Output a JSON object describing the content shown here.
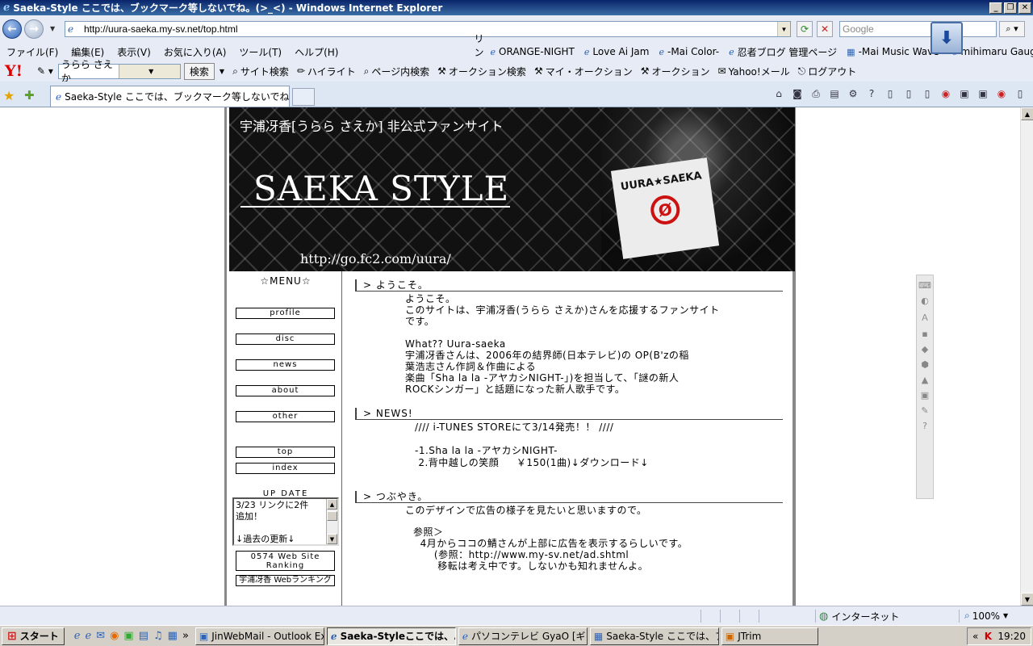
{
  "window": {
    "title": "Saeka-Style ここでは、ブックマーク等しないでね。(>_<) - Windows Internet Explorer",
    "btn_min": "_",
    "btn_max": "❐",
    "btn_close": "✕"
  },
  "address": {
    "url": "http://uura-saeka.my-sv.net/top.html",
    "search_placeholder": "Google"
  },
  "menubar": {
    "items": [
      "ファイル(F)",
      "編集(E)",
      "表示(V)",
      "お気に入り(A)",
      "ツール(T)",
      "ヘルプ(H)"
    ],
    "links_label": "リンク",
    "links": [
      "ORANGE-NIGHT",
      "Love Ai Jam",
      "-Mai Color-",
      "忍者ブログ 管理ページ",
      "-Mai Music Wave-",
      "mihimaru Gauge"
    ]
  },
  "yahoo_toolbar": {
    "logo": "Y!",
    "search_value": "うらら さえか",
    "search_button": "検索",
    "tools": [
      "サイト検索",
      "ハイライト",
      "ページ内検索",
      "オークション検索",
      "マイ・オークション",
      "オークション",
      "Yahoo!メール",
      "ログアウト"
    ]
  },
  "tabs": {
    "active_title": "Saeka-Style ここでは、ブックマーク等しないでね。(>_<)"
  },
  "site": {
    "header_sub": "宇浦冴香[うらら さえか] 非公式ファンサイト",
    "header_title": "SAEKA STYLE",
    "header_url": "http://go.fc2.com/uura/",
    "sign_text": "UURA★SAEKA",
    "sign_mark": "Ø",
    "menu_title": "☆MENU☆",
    "menu_buttons": [
      "profile",
      "disc",
      "news",
      "about",
      "other",
      "top",
      "index"
    ],
    "update_label": "UP DATE",
    "update_text": [
      "3/23 リンクに2件",
      "追加！",
      "↓過去の更新↓"
    ],
    "rank_box": "0574 Web Site Ranking",
    "rank_link": "宇浦冴香 Webランキング",
    "sections": {
      "welcome_head": "> ようこそ。",
      "welcome_body": "ようこそ。\nこのサイトは、宇浦冴香(うらら さえか)さんを応援するファンサイト\nです。\n\nWhat?? Uura-saeka\n宇浦冴香さんは、2006年の結界師(日本テレビ)の OP(B'zの稲\n葉浩志さん作詞＆作曲による\n楽曲「Sha la la -アヤカシNIGHT-」)を担当して、「謎の新人\nROCKシンガー」と話題になった新人歌手です。",
      "news_head": "> NEWS!",
      "news_body": "//// i-TUNES STOREにて3/14発売！！ ////\n\n-1.Sha la la -アヤカシNIGHT-\n 2.背中越しの笑顔     ￥150(1曲)↓ダウンロード↓",
      "tweet_head": "> つぶやき。",
      "tweet_body1": "このデザインで広告の様子を見たいと思いますので。",
      "tweet_body2": "参照＞\n  4月からココの鯖さんが上部に広告を表示するらしいです。\n      (参照：http://www.my-sv.net/ad.shtml\n       移転は考え中です。しないかも知れませんよ。"
    }
  },
  "status": {
    "zone": "インターネット",
    "zoom": "100%"
  },
  "taskbar": {
    "start": "スタート",
    "tasks": [
      "JinWebMail - Outlook Ex...",
      "Saeka-Styleここでは、...",
      "パソコンテレビ GyaO [ギャ...",
      "Saeka-Style ここでは、ブッ...",
      "JTrim"
    ],
    "clock": "19:20"
  }
}
